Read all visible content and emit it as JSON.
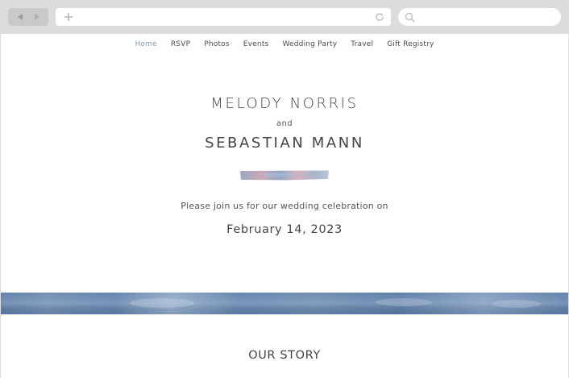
{
  "browser": {
    "back_icon": "back-arrow-icon",
    "forward_icon": "forward-arrow-icon",
    "new_tab_icon": "plus-icon",
    "reload_icon": "reload-icon",
    "search_icon": "search-icon"
  },
  "nav": {
    "items": [
      {
        "label": "Home",
        "active": true
      },
      {
        "label": "RSVP"
      },
      {
        "label": "Photos"
      },
      {
        "label": "Events"
      },
      {
        "label": "Wedding Party"
      },
      {
        "label": "Travel"
      },
      {
        "label": "Gift Registry"
      }
    ]
  },
  "hero": {
    "name1": "MELODY NORRIS",
    "conjunction": "and",
    "name2": "SEBASTIAN MANN",
    "invite_text": "Please join us for our wedding celebration on",
    "date": "February 14, 2023"
  },
  "story": {
    "heading": "OUR STORY"
  },
  "colors": {
    "accent_nav": "#7c9bb0",
    "band_blue": "#5a7aa6",
    "text": "#444444"
  }
}
